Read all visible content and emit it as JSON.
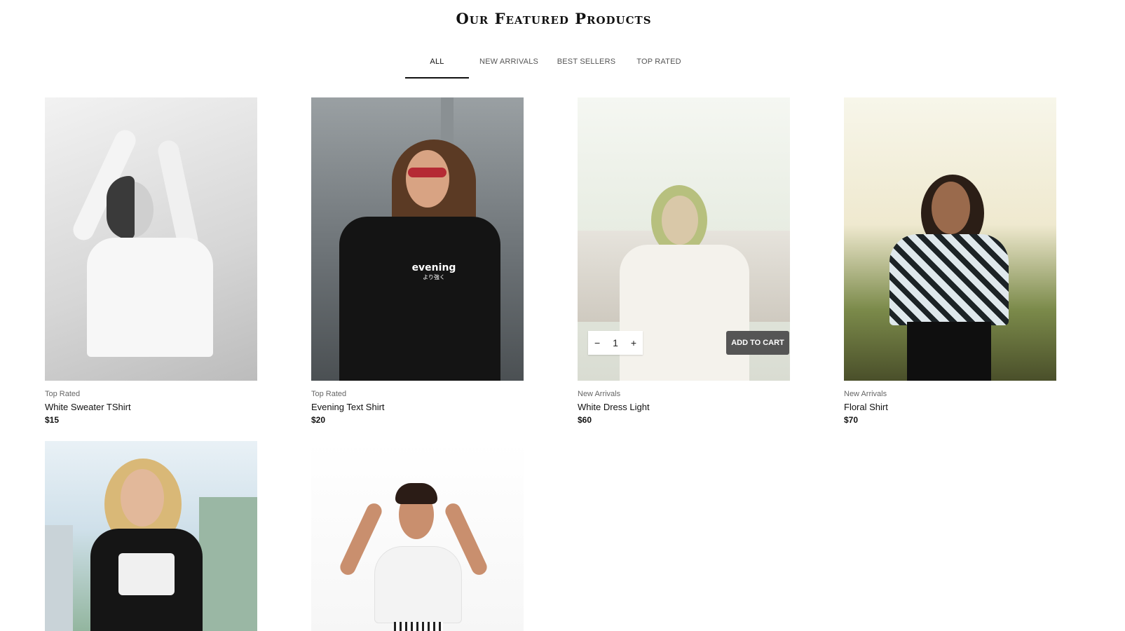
{
  "section": {
    "title": "Our Featured Products"
  },
  "tabs": [
    {
      "label": "ALL",
      "active": true
    },
    {
      "label": "NEW ARRIVALS",
      "active": false
    },
    {
      "label": "BEST SELLERS",
      "active": false
    },
    {
      "label": "TOP RATED",
      "active": false
    }
  ],
  "products": [
    {
      "category": "Top Rated",
      "name": "White Sweater TShirt",
      "price": "$15"
    },
    {
      "category": "Top Rated",
      "name": "Evening Text Shirt",
      "price": "$20",
      "print_text": "evening",
      "print_sub": "より強く"
    },
    {
      "category": "New Arrivals",
      "name": "White Dress Light",
      "price": "$60"
    },
    {
      "category": "New Arrivals",
      "name": "Floral Shirt",
      "price": "$70"
    },
    {
      "category": "",
      "name": "",
      "price": ""
    },
    {
      "category": "",
      "name": "",
      "price": ""
    }
  ],
  "cart": {
    "quantity": "1",
    "minus_icon": "minus-icon",
    "plus_icon": "plus-icon",
    "add_label": "ADD TO CART"
  },
  "colors": {
    "active_tab_underline": "#111111",
    "add_to_cart_bg": "#555555"
  }
}
